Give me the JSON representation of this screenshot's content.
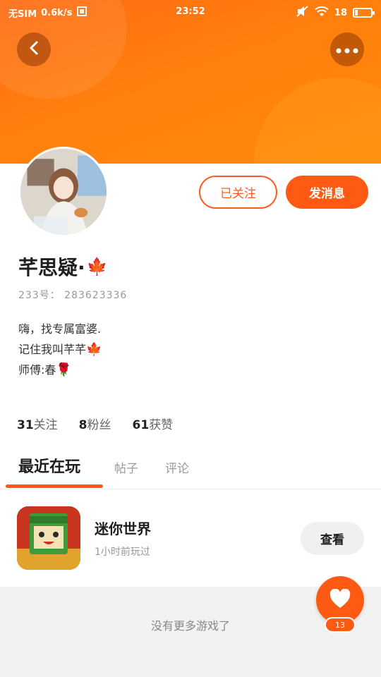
{
  "statusbar": {
    "sim": "无SIM",
    "speed": "0.6k/s",
    "time": "23:52",
    "battery_text": "18",
    "battery_level": 0.18
  },
  "profile": {
    "follow_label": "已关注",
    "message_label": "发消息",
    "username": "芊思疑·",
    "username_emoji": "🍁",
    "uid": "233号： 283623336",
    "bio": [
      {
        "text": "嗨，找专属富婆.",
        "emoji": ""
      },
      {
        "text": "记住我叫芊芊",
        "emoji": "🍁"
      },
      {
        "text": "师傅:春",
        "emoji": "🌹"
      }
    ],
    "stats": [
      {
        "num": "31",
        "label": "关注"
      },
      {
        "num": "8",
        "label": "粉丝"
      },
      {
        "num": "61",
        "label": "获赞"
      }
    ]
  },
  "tabs": [
    {
      "label": "最近在玩",
      "active": true
    },
    {
      "label": "帖子",
      "active": false
    },
    {
      "label": "评论",
      "active": false
    }
  ],
  "game": {
    "name": "迷你世界",
    "played": "1小时前玩过",
    "view_label": "查看"
  },
  "footer": {
    "no_more": "没有更多游戏了"
  },
  "fab": {
    "count": "13",
    "icon": "heart-icon"
  },
  "colors": {
    "accent": "#ff5a14",
    "header_start": "#ff6a12",
    "header_end": "#ff8a0c"
  }
}
